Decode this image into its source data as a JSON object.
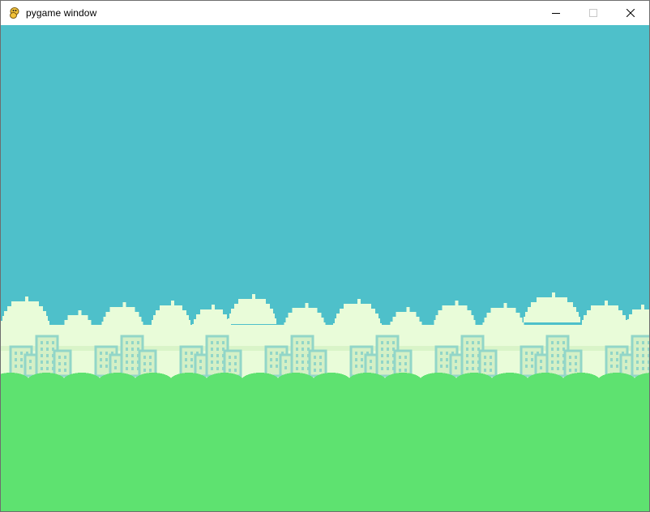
{
  "window": {
    "title": "pygame window",
    "icon": "pygame-snake-icon",
    "controls": [
      "minimize-icon",
      "maximize-icon",
      "close-icon"
    ]
  },
  "scene": {
    "sky_color": "#4ec0ca",
    "cloud_color": "#e9fcd9",
    "cloud_shadow_color": "#d9f4c8",
    "building_fill_color": "#d4f0c6",
    "building_outline_color": "#92d6c8",
    "bush_color": "#5ee270",
    "bush_dark_color": "#54c96a",
    "ground_color": "#5ee270"
  }
}
